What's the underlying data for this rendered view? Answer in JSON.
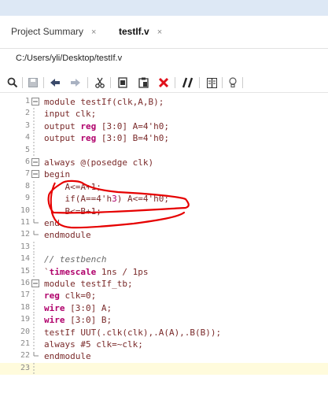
{
  "tabs": [
    {
      "label": "Project Summary",
      "close": "×"
    },
    {
      "label": "testIf.v",
      "close": "×"
    }
  ],
  "path": "C:/Users/yli/Desktop/testIf.v",
  "toolbar_icons": [
    "search-icon",
    "save-icon",
    "back-icon",
    "forward-icon",
    "cut-icon",
    "copy-icon",
    "paste-icon",
    "delete-icon",
    "comment-icon",
    "split-icon",
    "bulb-icon"
  ],
  "colors": {
    "keyword": "#b0006b",
    "code": "#7a2a2a",
    "annotation_red": "#e60000",
    "current_line": "#fffbdc"
  },
  "code_lines": [
    {
      "n": "1",
      "fold": "open",
      "t": "module testIf(clk,A,B);"
    },
    {
      "n": "2",
      "t": "input clk;"
    },
    {
      "n": "3",
      "t": "output reg [3:0] A=4'h0;"
    },
    {
      "n": "4",
      "t": "output reg [3:0] B=4'h0;"
    },
    {
      "n": "5",
      "t": ""
    },
    {
      "n": "6",
      "fold": "open",
      "t": "always @(posedge clk)"
    },
    {
      "n": "7",
      "fold": "open",
      "t": "begin"
    },
    {
      "n": "8",
      "t": "    A<=A+1;"
    },
    {
      "n": "9",
      "t": "    if(A==4'h3) A<=4'h0;"
    },
    {
      "n": "10",
      "t": "    B<=B+1;"
    },
    {
      "n": "11",
      "fold": "end",
      "t": "end"
    },
    {
      "n": "12",
      "fold": "end",
      "t": "endmodule"
    },
    {
      "n": "13",
      "t": ""
    },
    {
      "n": "14",
      "t": "// testbench"
    },
    {
      "n": "15",
      "t": "`timescale 1ns / 1ps"
    },
    {
      "n": "16",
      "fold": "open",
      "t": "module testIf_tb;"
    },
    {
      "n": "17",
      "t": "reg clk=0;"
    },
    {
      "n": "18",
      "t": "wire [3:0] A;"
    },
    {
      "n": "19",
      "t": "wire [3:0] B;"
    },
    {
      "n": "20",
      "t": "testIf UUT(.clk(clk),.A(A),.B(B));"
    },
    {
      "n": "21",
      "t": "always #5 clk=~clk;"
    },
    {
      "n": "22",
      "fold": "end",
      "t": "endmodule"
    },
    {
      "n": "23",
      "t": ""
    }
  ]
}
